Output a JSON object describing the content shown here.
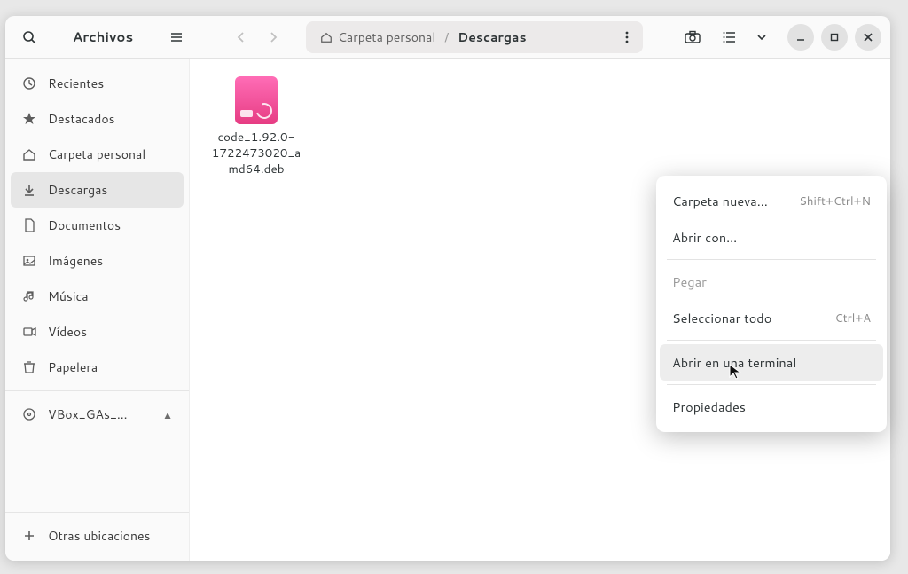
{
  "header": {
    "app_title": "Archivos"
  },
  "breadcrumb": {
    "parent": "Carpeta personal",
    "current": "Descargas"
  },
  "sidebar": {
    "items": [
      {
        "label": "Recientes",
        "icon": "clock-icon"
      },
      {
        "label": "Destacados",
        "icon": "star-icon"
      },
      {
        "label": "Carpeta personal",
        "icon": "home-icon"
      },
      {
        "label": "Descargas",
        "icon": "download-icon",
        "active": true
      },
      {
        "label": "Documentos",
        "icon": "document-icon"
      },
      {
        "label": "Imágenes",
        "icon": "image-icon"
      },
      {
        "label": "Música",
        "icon": "music-icon"
      },
      {
        "label": "Vídeos",
        "icon": "video-icon"
      },
      {
        "label": "Papelera",
        "icon": "trash-icon"
      }
    ],
    "removable": {
      "label": "VBox_GAs_…",
      "icon": "disc-icon"
    },
    "other": {
      "label": "Otras ubicaciones",
      "icon": "plus-icon"
    }
  },
  "files": [
    {
      "name": "code_1.92.0-1722473020_amd64.deb"
    }
  ],
  "context_menu": {
    "items": [
      {
        "label": "Carpeta nueva…",
        "accel": "Shift+Ctrl+N"
      },
      {
        "label": "Abrir con…"
      }
    ],
    "items2": [
      {
        "label": "Pegar",
        "disabled": true
      },
      {
        "label": "Seleccionar todo",
        "accel": "Ctrl+A"
      }
    ],
    "items3": [
      {
        "label": "Abrir en una terminal",
        "highlight": true
      }
    ],
    "items4": [
      {
        "label": "Propiedades"
      }
    ]
  }
}
